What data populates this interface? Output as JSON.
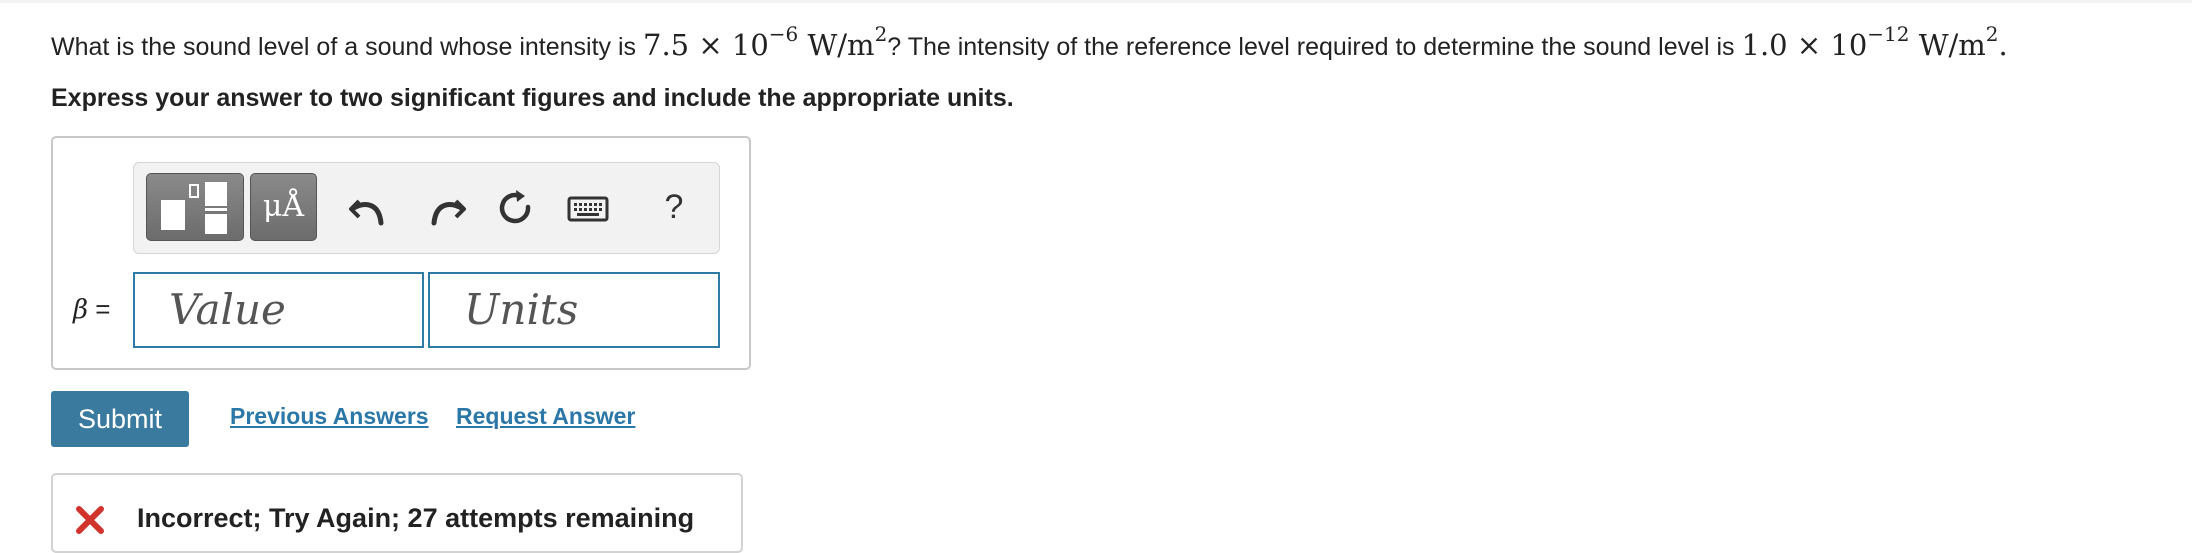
{
  "question": {
    "part1": "What is the sound level of a sound whose intensity is ",
    "intensity_mantissa": "7.5",
    "times": "×",
    "intensity_base": "10",
    "intensity_exp": "−6",
    "unit_w": "W/m",
    "unit_exp": "2",
    "part2": "? The intensity of the reference level required to determine the sound level is ",
    "ref_mantissa": "1.0",
    "ref_base": "10",
    "ref_exp": "−12",
    "end": "."
  },
  "instruction": "Express your answer to two significant figures and include the appropriate units.",
  "toolbar": {
    "templates_icon": "templates-icon",
    "units_label": "μÅ",
    "undo_icon": "undo-icon",
    "redo_icon": "redo-icon",
    "reset_icon": "reset-icon",
    "keyboard_icon": "keyboard-icon",
    "help_label": "?"
  },
  "answer": {
    "variable": "β",
    "equals": "=",
    "value_placeholder": "Value",
    "units_placeholder": "Units"
  },
  "actions": {
    "submit_label": "Submit",
    "previous_answers_label": "Previous Answers",
    "request_answer_label": "Request Answer"
  },
  "feedback": {
    "text": "Incorrect; Try Again; 27 attempts remaining",
    "icon": "incorrect-x-icon",
    "color": "#d0342c"
  },
  "colors": {
    "accent": "#3a7a9f",
    "link": "#2b77a7",
    "field_border": "#2d7ba6"
  }
}
